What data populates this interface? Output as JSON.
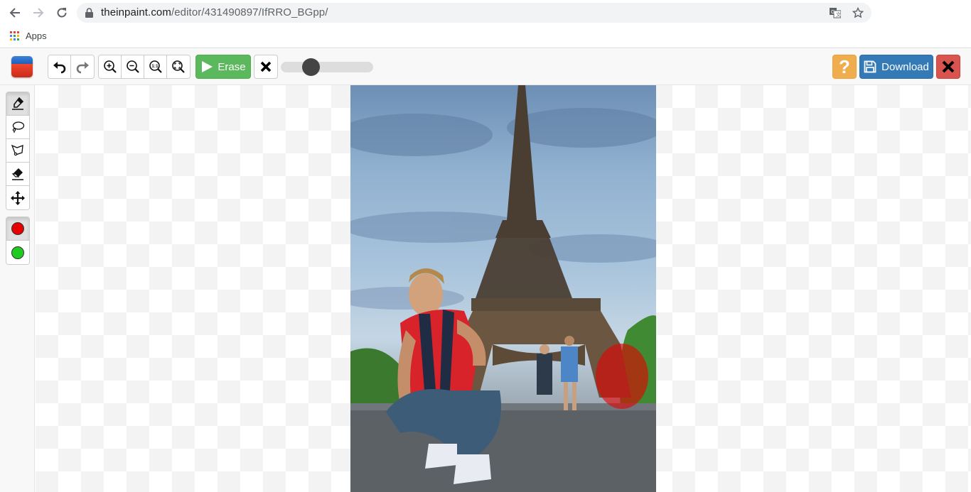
{
  "browser": {
    "url_host": "theinpaint.com",
    "url_path": "/editor/431490897/IfRRO_BGpp/",
    "bookmarks": [
      {
        "label": "Apps",
        "icon": "apps-grid-icon"
      }
    ],
    "icons": {
      "back": "arrow-left-icon",
      "forward": "arrow-right-icon",
      "reload": "reload-icon",
      "secure": "lock-icon",
      "translate": "translate-icon",
      "bookmark": "star-icon"
    }
  },
  "toolbar": {
    "undo_icon": "undo-icon",
    "redo_icon": "redo-icon",
    "zoom_buttons": [
      {
        "name": "zoom-in",
        "icon": "zoom-in-icon"
      },
      {
        "name": "zoom-out",
        "icon": "zoom-out-icon"
      },
      {
        "name": "zoom-actual",
        "icon": "zoom-1-1-icon",
        "glyph": "1:1"
      },
      {
        "name": "zoom-fit",
        "icon": "zoom-fit-icon"
      }
    ],
    "erase_label": "Erase",
    "help_label": "?",
    "download_label": "Download",
    "brush_size_fraction": 0.32,
    "colors": {
      "erase": "#5cb85c",
      "help": "#f0ad4e",
      "download": "#337ab7",
      "close": "#d9534f"
    }
  },
  "sidebar": {
    "tools": [
      {
        "name": "marker",
        "icon": "marker-icon",
        "active": true
      },
      {
        "name": "lasso",
        "icon": "lasso-icon",
        "active": false
      },
      {
        "name": "polygon-lasso",
        "icon": "polygon-lasso-icon",
        "active": false
      },
      {
        "name": "eraser",
        "icon": "eraser-icon",
        "active": false
      },
      {
        "name": "move",
        "icon": "move-icon",
        "active": false
      }
    ],
    "mask_colors": [
      {
        "name": "red-mask",
        "color": "#e60000",
        "active": true
      },
      {
        "name": "green-mask",
        "color": "#1ecb1e",
        "active": false
      }
    ]
  },
  "canvas": {
    "image_description": "Man in red t-shirt crouching in front of the Eiffel Tower under a cloudy sky",
    "mask_description": "Red marker mask over people on the right"
  }
}
